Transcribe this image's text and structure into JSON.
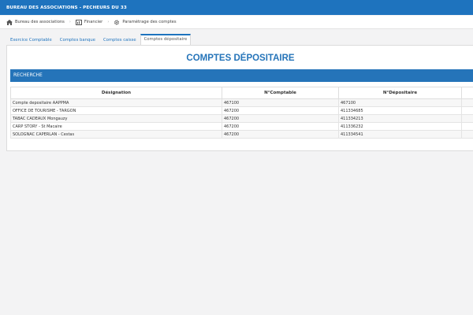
{
  "app": {
    "title": "BUREAU DES ASSOCIATIONS - PECHEURS DU 33"
  },
  "breadcrumb": {
    "items": [
      {
        "label": "Bureau des associations",
        "icon": "home-icon"
      },
      {
        "label": "Financier",
        "icon": "dashboard-icon"
      },
      {
        "label": "Paramétrage des comptes",
        "icon": "gear-icon"
      }
    ]
  },
  "tabs": [
    {
      "label": "Exercice Comptable",
      "active": false
    },
    {
      "label": "Comptes banque",
      "active": false
    },
    {
      "label": "Comptes caisse",
      "active": false
    },
    {
      "label": "Comptes dépositaire",
      "active": true
    }
  ],
  "main": {
    "title": "COMPTES DÉPOSITAIRE",
    "search_label": "RECHERCHE",
    "table": {
      "headers": [
        "Désignation",
        "N°Comptable",
        "N°Dépositaire"
      ],
      "rows": [
        [
          "Compte depositaire AAPPMA",
          "467100",
          "467100"
        ],
        [
          "OFFICE DE TOURISME - TARGON",
          "467200",
          "411334685"
        ],
        [
          "TABAC CADEAUX Mongauzy",
          "467200",
          "411334213"
        ],
        [
          "CARP STORY - St Macaire",
          "467200",
          "411336232"
        ],
        [
          "SOLOGNAC CAPERLAN - Cestas",
          "467200",
          "411334541"
        ]
      ]
    }
  },
  "colors": {
    "brand": "#1e73be",
    "title": "#2574b9"
  }
}
